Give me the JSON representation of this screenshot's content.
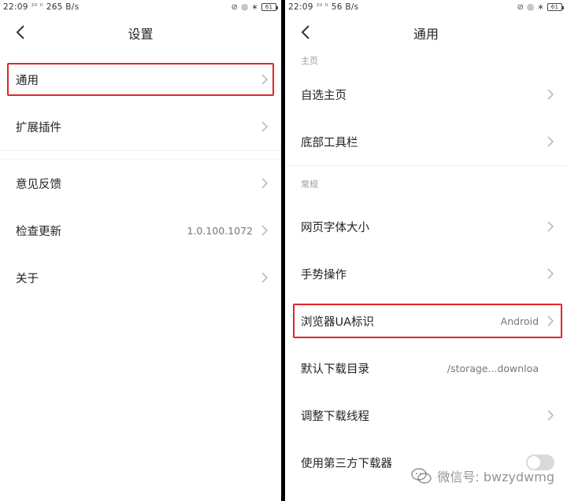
{
  "left": {
    "status": {
      "time": "22:09",
      "signal": "²ᴵᴵ ᴵᴵ",
      "speed": "265 B/s",
      "battery": "61"
    },
    "title": "设置",
    "rows": [
      {
        "label": "通用",
        "value": ""
      },
      {
        "label": "扩展插件",
        "value": ""
      },
      {
        "label": "意见反馈",
        "value": ""
      },
      {
        "label": "检查更新",
        "value": "1.0.100.1072"
      },
      {
        "label": "关于",
        "value": ""
      }
    ]
  },
  "right": {
    "status": {
      "time": "22:09",
      "signal": "²ᴵᴵ ᴵᴵ",
      "speed": "56 B/s",
      "battery": "61"
    },
    "title": "通用",
    "sections": [
      {
        "header": "主页",
        "rows": [
          {
            "label": "自选主页",
            "value": ""
          },
          {
            "label": "底部工具栏",
            "value": ""
          }
        ]
      },
      {
        "header": "常规",
        "rows": [
          {
            "label": "网页字体大小",
            "value": ""
          },
          {
            "label": "手势操作",
            "value": ""
          },
          {
            "label": "浏览器UA标识",
            "value": "Android"
          },
          {
            "label": "默认下载目录",
            "value": "/storage...downloa"
          },
          {
            "label": "调整下载线程",
            "value": ""
          },
          {
            "label": "使用第三方下载器",
            "value": ""
          }
        ]
      }
    ]
  },
  "watermark": "微信号: bwzydwmg",
  "colors": {
    "highlight": "#e0262a",
    "text": "#222222",
    "muted": "#9a9a9a"
  },
  "icons": [
    "back-icon",
    "chevron-right-icon",
    "toggle-switch",
    "wechat-icon"
  ]
}
